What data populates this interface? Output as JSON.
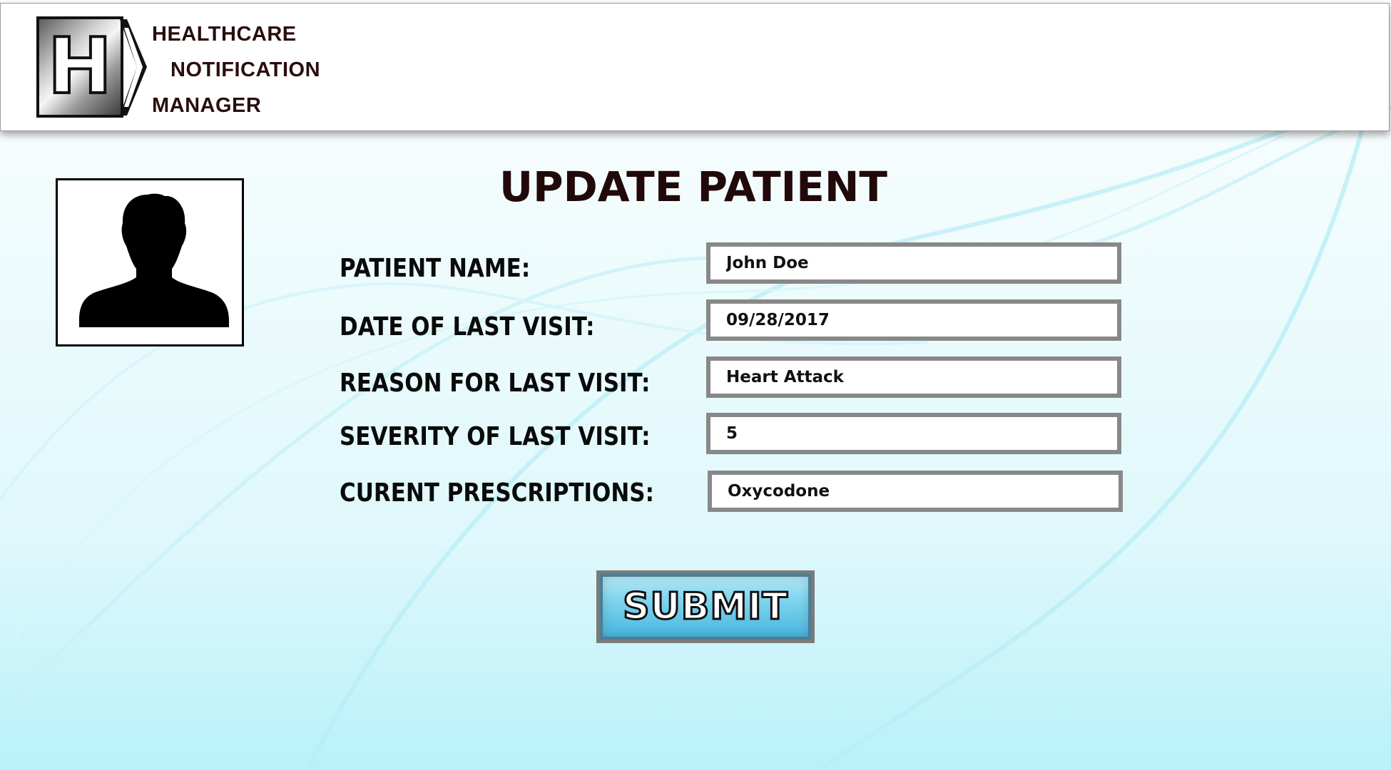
{
  "header": {
    "brand_lines": [
      "HEALTHCARE",
      "NOTIFICATION",
      "MANAGER"
    ],
    "logo_letter": "H",
    "logo_icon": "h-hospital-logo-icon"
  },
  "avatar": {
    "icon": "person-silhouette-icon"
  },
  "page": {
    "title": "UPDATE PATIENT"
  },
  "form": {
    "fields": [
      {
        "label": "PATIENT NAME:",
        "value": "John Doe"
      },
      {
        "label": "DATE OF LAST VISIT:",
        "value": "09/28/2017"
      },
      {
        "label": "REASON FOR LAST VISIT:",
        "value": "Heart Attack"
      },
      {
        "label": "SEVERITY OF LAST VISIT:",
        "value": "5"
      },
      {
        "label": "CURENT PRESCRIPTIONS:",
        "value": "Oxycodone"
      }
    ],
    "submit_label": "SUBMIT"
  },
  "colors": {
    "title_text": "#220909",
    "brand_text": "#2a0d0d",
    "input_border": "#888888",
    "button_blue": "#45b4dd",
    "background_cyan": "#b8f1fa"
  }
}
